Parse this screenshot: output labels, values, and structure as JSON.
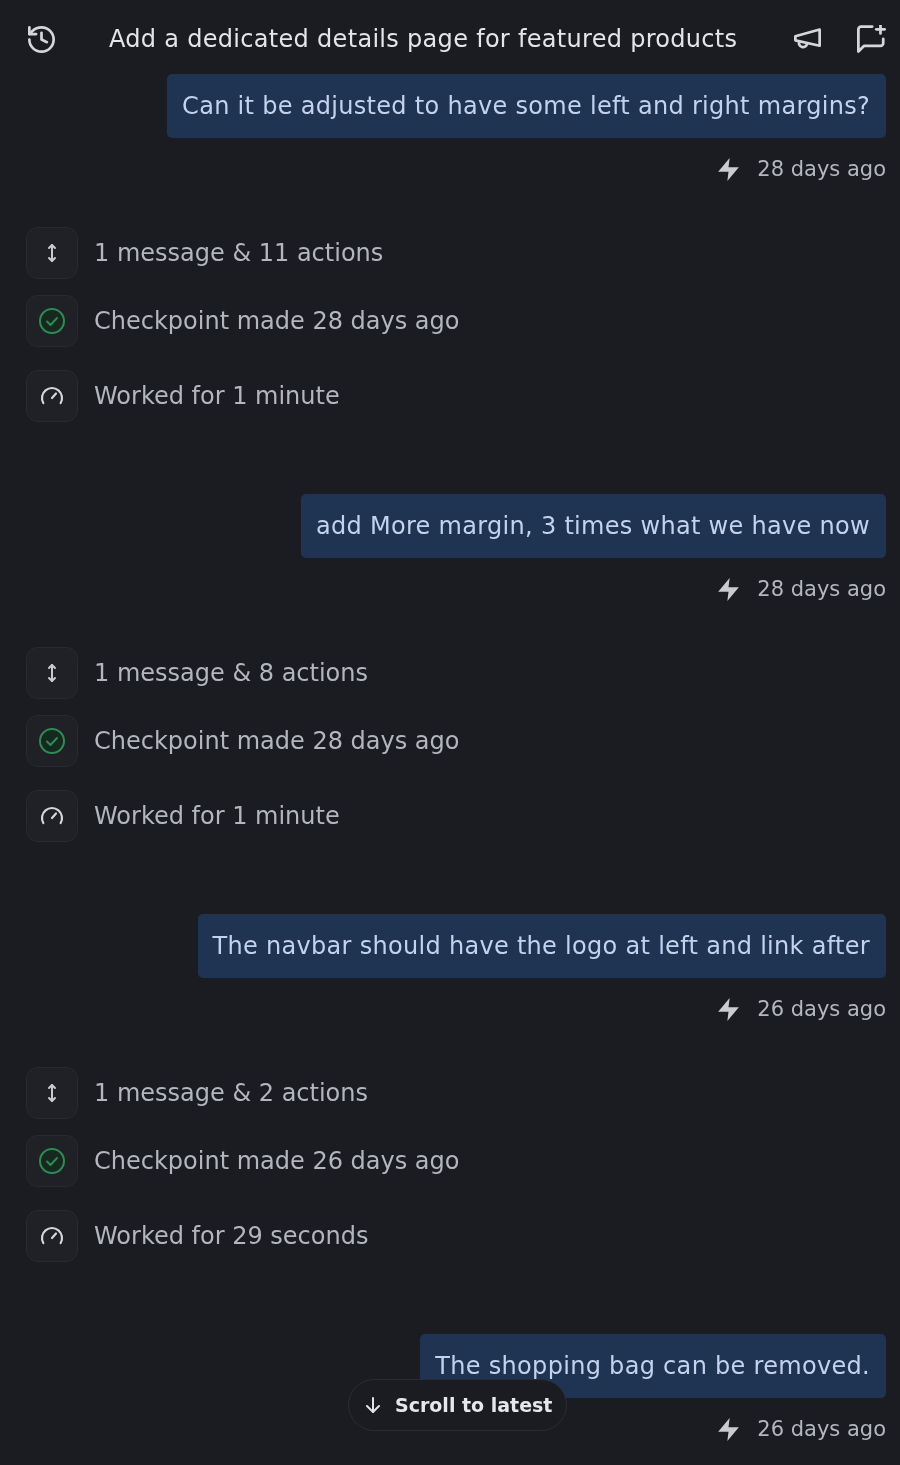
{
  "header": {
    "title": "Add a dedicated details page for featured products"
  },
  "feed": [
    {
      "kind": "message",
      "text": "Can it be adjusted to have some left and right margins?",
      "time": "28 days ago"
    },
    {
      "kind": "actions",
      "label": "1 message & 11 actions"
    },
    {
      "kind": "checkpoint",
      "label": "Checkpoint made 28 days ago"
    },
    {
      "kind": "worked",
      "label": "Worked for 1 minute"
    },
    {
      "kind": "message",
      "text": "add More margin, 3 times what we have now",
      "time": "28 days ago"
    },
    {
      "kind": "actions",
      "label": "1 message & 8 actions"
    },
    {
      "kind": "checkpoint",
      "label": "Checkpoint made 28 days ago"
    },
    {
      "kind": "worked",
      "label": "Worked for 1 minute"
    },
    {
      "kind": "message",
      "text": "The navbar should have the logo at left and link after",
      "time": "26 days ago"
    },
    {
      "kind": "actions",
      "label": "1 message & 2 actions"
    },
    {
      "kind": "checkpoint",
      "label": "Checkpoint made 26 days ago"
    },
    {
      "kind": "worked",
      "label": "Worked for 29 seconds"
    },
    {
      "kind": "message",
      "text": "The shopping bag can be removed.",
      "time": "26 days ago"
    }
  ],
  "scroll_button": {
    "label": "Scroll to latest"
  }
}
